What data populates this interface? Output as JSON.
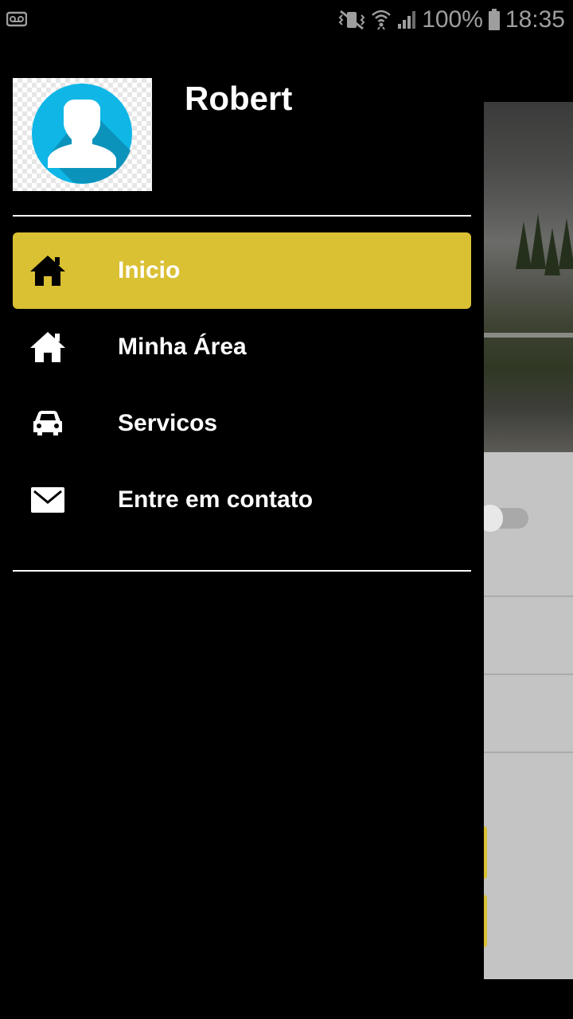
{
  "status_bar": {
    "icons": [
      "voicemail-icon",
      "mute-vibrate-icon",
      "wifi-icon",
      "signal-icon",
      "battery-icon"
    ],
    "battery": "100%",
    "time": "18:35"
  },
  "drawer": {
    "user": {
      "name": "Robert",
      "avatar": "default-user-avatar-icon"
    },
    "menu": [
      {
        "label": "Inicio",
        "icon": "home-icon",
        "active": true
      },
      {
        "label": "Minha Área",
        "icon": "home-icon",
        "active": false
      },
      {
        "label": "Servicos",
        "icon": "car-icon",
        "active": false
      },
      {
        "label": "Entre em contato",
        "icon": "mail-icon",
        "active": false
      }
    ]
  },
  "colors": {
    "accent": "#dac033",
    "drawer_bg": "#000000",
    "avatar_blue": "#0fb6e6",
    "text": "#ffffff"
  }
}
